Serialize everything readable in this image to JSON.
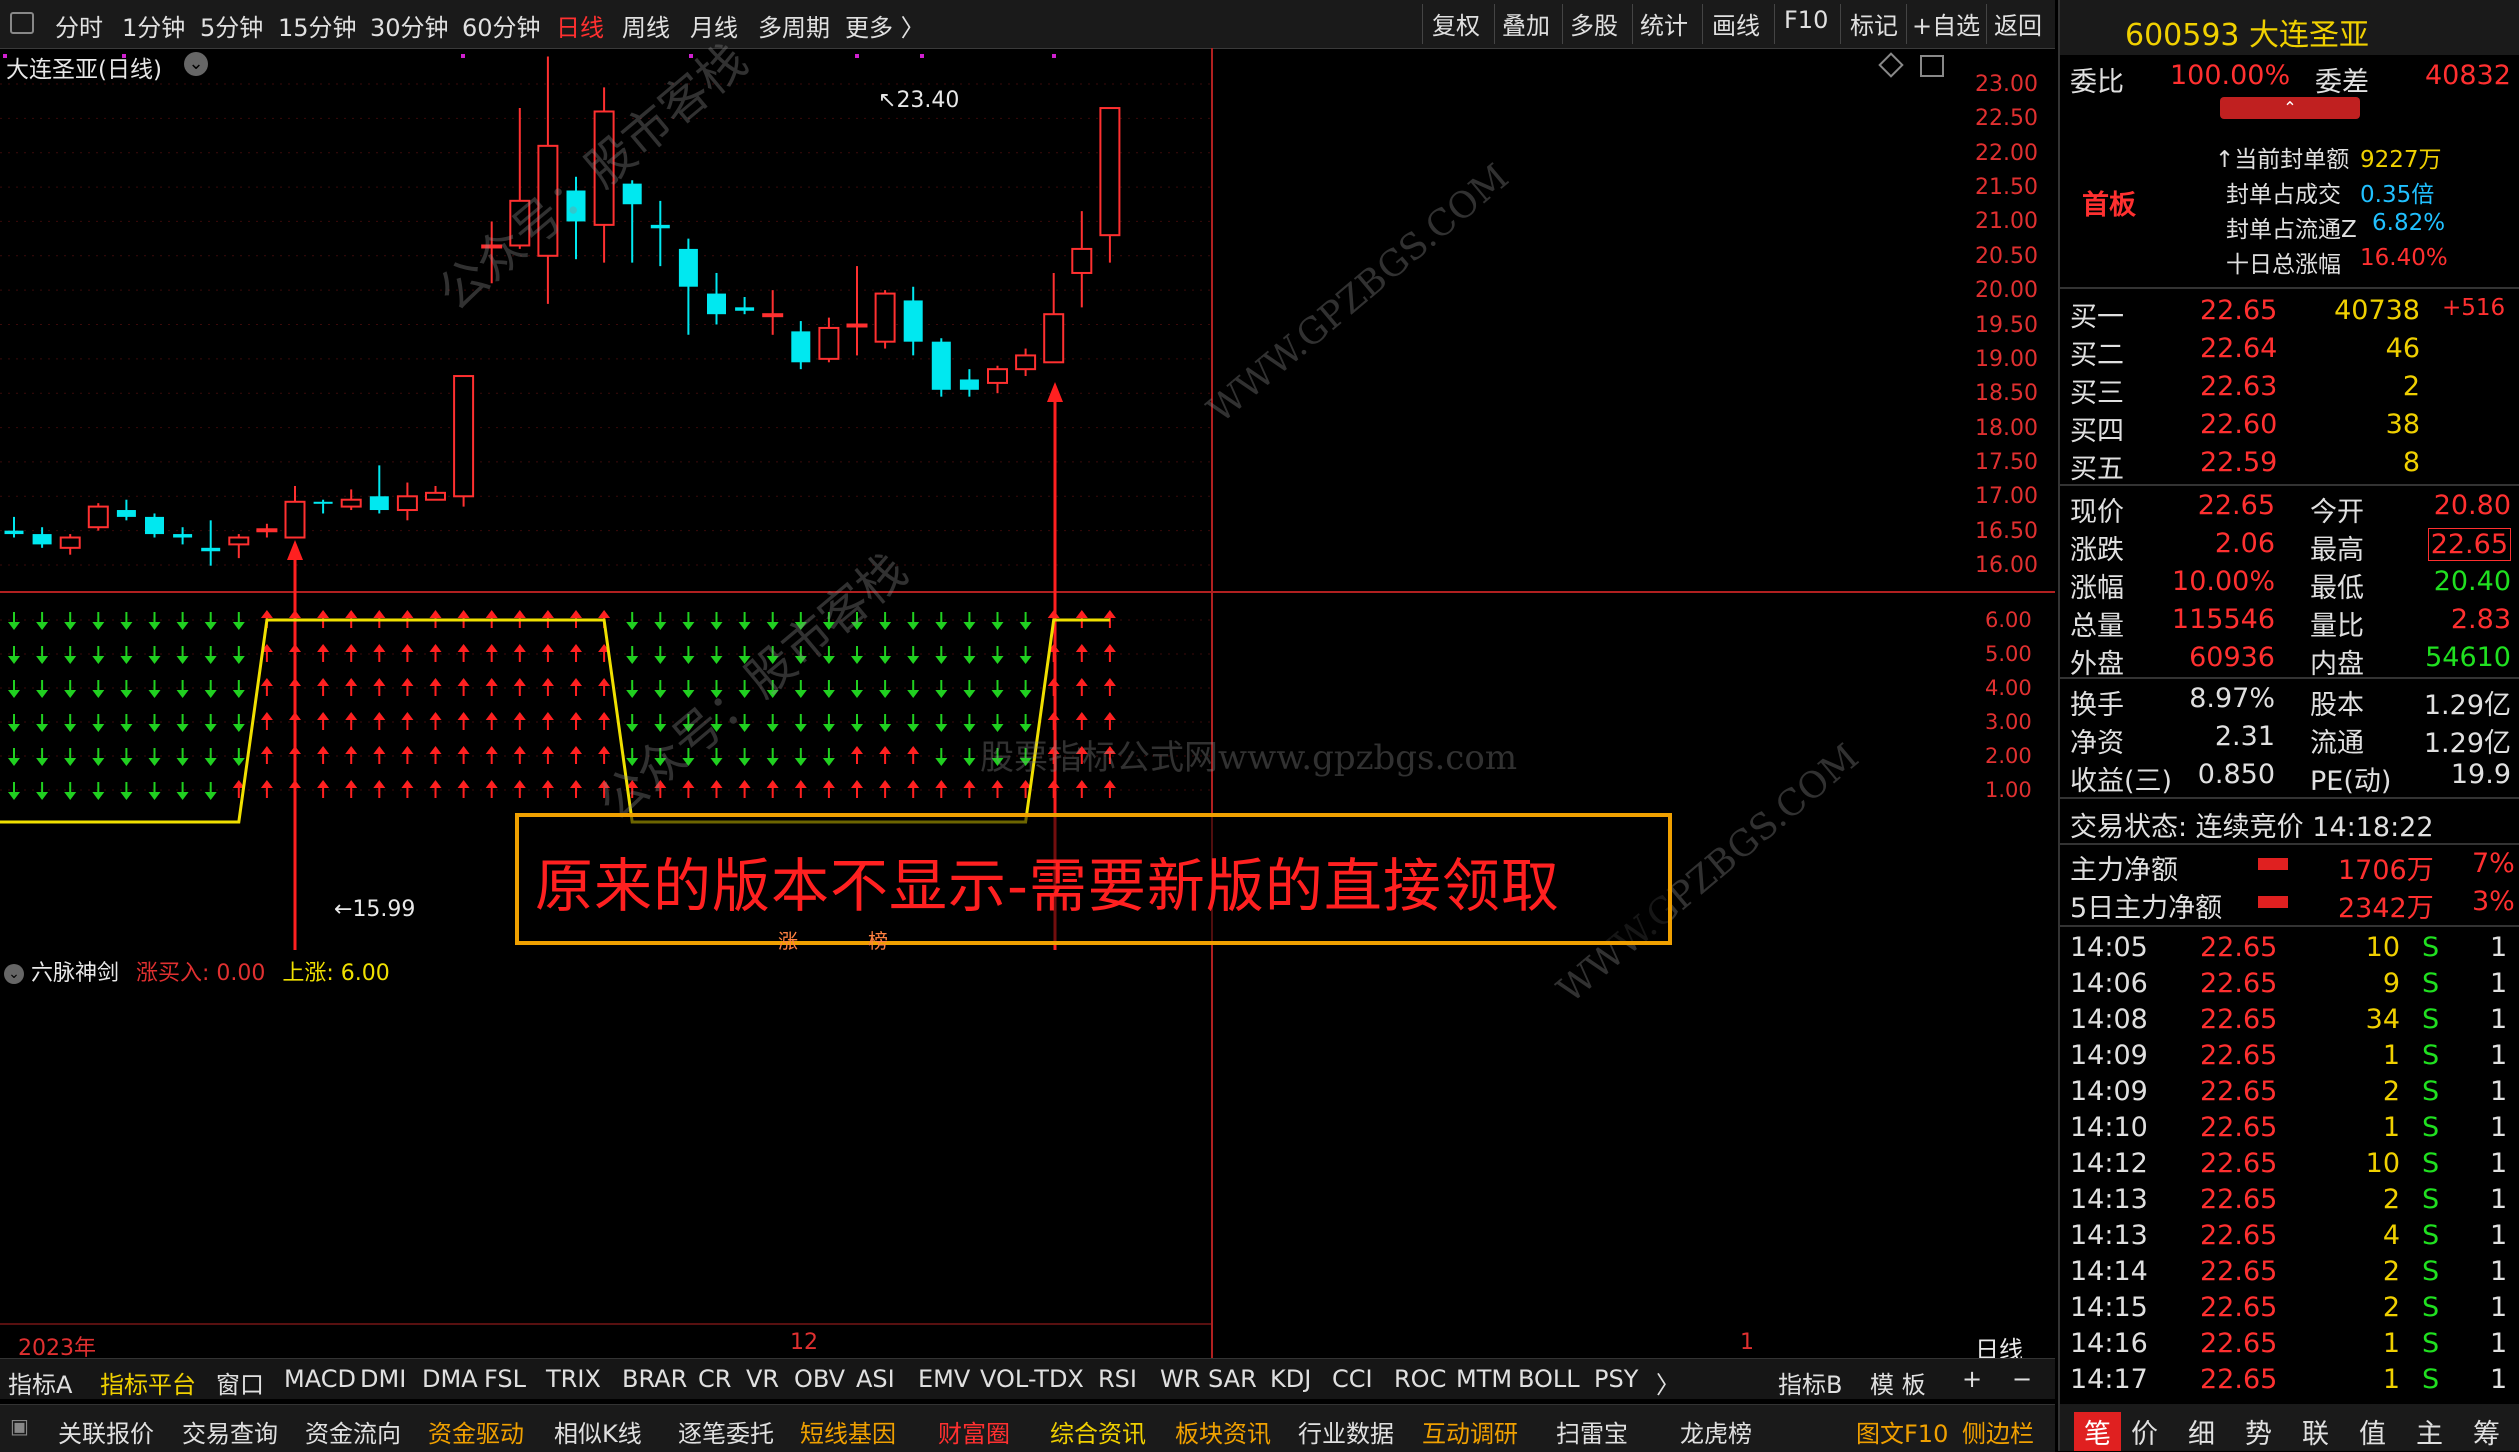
{
  "toolbar": {
    "periods": [
      "分时",
      "1分钟",
      "5分钟",
      "15分钟",
      "30分钟",
      "60分钟",
      "日线",
      "周线",
      "月线",
      "多周期",
      "更多 〉"
    ],
    "active_period": "日线",
    "buttons": [
      "复权",
      "叠加",
      "多股",
      "统计",
      "画线",
      "F10",
      "标记",
      "+自选",
      "返回"
    ]
  },
  "chart": {
    "title": "大连圣亚(日线)",
    "high_marker": "23.40",
    "low_marker": "15.99",
    "price_ticks": [
      "23.00",
      "22.50",
      "22.00",
      "21.50",
      "21.00",
      "20.50",
      "20.00",
      "19.50",
      "19.00",
      "18.50",
      "18.00",
      "17.50",
      "17.00",
      "16.50",
      "16.00"
    ],
    "watermark_center": "股票指标公式网www.gpzbgs.com",
    "watermark_side": "公众号：股市客栈",
    "watermark_url": "WWW.GPZBGS.COM",
    "notice": "原来的版本不显示-需要新版的直接领取",
    "tag_1": "涨",
    "tag_2": "榜",
    "x_label_1": "2023年",
    "x_label_2": "12",
    "x_label_3": "1",
    "corner_label": "日线"
  },
  "indicator": {
    "name": "六脉神剑",
    "line1": "涨买入: 0.00",
    "line2": "上涨: 6.00",
    "ticks": [
      "6.00",
      "5.00",
      "4.00",
      "3.00",
      "2.00",
      "1.00"
    ],
    "up_color": "#ff2020",
    "down_color": "#20d020"
  },
  "tabs": [
    "指标A",
    "指标平台",
    "窗口",
    "MACD",
    "DMI",
    "DMA",
    "FSL",
    "TRIX",
    "BRAR",
    "CR",
    "VR",
    "OBV",
    "ASI",
    "EMV",
    "VOL-TDX",
    "RSI",
    "WR",
    "SAR",
    "KDJ",
    "CCI",
    "ROC",
    "MTM",
    "BOLL",
    "PSY",
    "〉"
  ],
  "tabs_right": [
    "指标B",
    "模 板",
    "+",
    "−"
  ],
  "bottom_buttons": [
    "关联报价",
    "交易查询",
    "资金流向",
    "资金驱动",
    "相似K线",
    "逐笔委托",
    "短线基因",
    "财富圈",
    "综合资讯",
    "板块资讯",
    "行业数据",
    "互动调研",
    "扫雷宝",
    "龙虎榜",
    "图文F10",
    "侧边栏"
  ],
  "quote": {
    "code_name": "600593 大连圣亚",
    "weibi_label": "委比",
    "weibi": "100.00%",
    "weicha_label": "委差",
    "weicha": "40832",
    "badge": "首板",
    "seal_amount_label": "当前封单额",
    "seal_amount": "9227万",
    "seal_ratio_label": "封单占成交",
    "seal_ratio": "0.35倍",
    "seal_float_label": "封单占流通Z",
    "seal_float": "6.82%",
    "ten_day_label": "十日总涨幅",
    "ten_day": "16.40%",
    "bids": [
      {
        "label": "买一",
        "price": "22.65",
        "vol": "40738",
        "chg": "+516"
      },
      {
        "label": "买二",
        "price": "22.64",
        "vol": "46",
        "chg": ""
      },
      {
        "label": "买三",
        "price": "22.63",
        "vol": "2",
        "chg": ""
      },
      {
        "label": "买四",
        "price": "22.60",
        "vol": "38",
        "chg": ""
      },
      {
        "label": "买五",
        "price": "22.59",
        "vol": "8",
        "chg": ""
      }
    ],
    "stats": [
      {
        "l1": "现价",
        "v1": "22.65",
        "l2": "今开",
        "v2": "20.80"
      },
      {
        "l1": "涨跌",
        "v1": "2.06",
        "l2": "最高",
        "v2": "22.65"
      },
      {
        "l1": "涨幅",
        "v1": "10.00%",
        "l2": "最低",
        "v2": "20.40"
      },
      {
        "l1": "总量",
        "v1": "115546",
        "l2": "量比",
        "v2": "2.83"
      },
      {
        "l1": "外盘",
        "v1": "60936",
        "l2": "内盘",
        "v2": "54610"
      }
    ],
    "stats2": [
      {
        "l1": "换手",
        "v1": "8.97%",
        "l2": "股本",
        "v2": "1.29亿"
      },
      {
        "l1": "净资",
        "v1": "2.31",
        "l2": "流通",
        "v2": "1.29亿"
      },
      {
        "l1": "收益(三)",
        "v1": "0.850",
        "l2": "PE(动)",
        "v2": "19.9"
      }
    ],
    "trade_status": "交易状态: 连续竞价 14:18:22",
    "main_net_label": "主力净额",
    "main_net": "1706万",
    "main_net_pct": "7%",
    "main_net5_label": "5日主力净额",
    "main_net5": "2342万",
    "main_net5_pct": "3%",
    "ticks": [
      {
        "t": "14:05",
        "p": "22.65",
        "v": "10",
        "s": "S",
        "n": "1"
      },
      {
        "t": "14:06",
        "p": "22.65",
        "v": "9",
        "s": "S",
        "n": "1"
      },
      {
        "t": "14:08",
        "p": "22.65",
        "v": "34",
        "s": "S",
        "n": "1"
      },
      {
        "t": "14:09",
        "p": "22.65",
        "v": "1",
        "s": "S",
        "n": "1"
      },
      {
        "t": "14:09",
        "p": "22.65",
        "v": "2",
        "s": "S",
        "n": "1"
      },
      {
        "t": "14:10",
        "p": "22.65",
        "v": "1",
        "s": "S",
        "n": "1"
      },
      {
        "t": "14:12",
        "p": "22.65",
        "v": "10",
        "s": "S",
        "n": "1"
      },
      {
        "t": "14:13",
        "p": "22.65",
        "v": "2",
        "s": "S",
        "n": "1"
      },
      {
        "t": "14:13",
        "p": "22.65",
        "v": "4",
        "s": "S",
        "n": "1"
      },
      {
        "t": "14:14",
        "p": "22.65",
        "v": "2",
        "s": "S",
        "n": "1"
      },
      {
        "t": "14:15",
        "p": "22.65",
        "v": "2",
        "s": "S",
        "n": "1"
      },
      {
        "t": "14:16",
        "p": "22.65",
        "v": "1",
        "s": "S",
        "n": "1"
      },
      {
        "t": "14:17",
        "p": "22.65",
        "v": "1",
        "s": "S",
        "n": "1"
      }
    ],
    "bottom_tabs": [
      "笔",
      "价",
      "细",
      "势",
      "联",
      "值",
      "主",
      "筹"
    ]
  },
  "chart_data": {
    "type": "candlestick",
    "title": "大连圣亚(日线)",
    "ylim": [
      15.9,
      23.5
    ],
    "candles": [
      {
        "o": 16.5,
        "c": 16.45,
        "h": 16.7,
        "l": 16.4
      },
      {
        "o": 16.45,
        "c": 16.3,
        "h": 16.55,
        "l": 16.25
      },
      {
        "o": 16.25,
        "c": 16.4,
        "h": 16.45,
        "l": 16.15
      },
      {
        "o": 16.55,
        "c": 16.85,
        "h": 16.9,
        "l": 16.5
      },
      {
        "o": 16.8,
        "c": 16.7,
        "h": 16.95,
        "l": 16.65
      },
      {
        "o": 16.7,
        "c": 16.45,
        "h": 16.75,
        "l": 16.4
      },
      {
        "o": 16.45,
        "c": 16.4,
        "h": 16.55,
        "l": 16.3
      },
      {
        "o": 16.25,
        "c": 16.2,
        "h": 16.65,
        "l": 15.99
      },
      {
        "o": 16.3,
        "c": 16.4,
        "h": 16.45,
        "l": 16.1
      },
      {
        "o": 16.5,
        "c": 16.52,
        "h": 16.6,
        "l": 16.4
      },
      {
        "o": 16.4,
        "c": 16.92,
        "h": 17.15,
        "l": 16.4
      },
      {
        "o": 16.92,
        "c": 16.9,
        "h": 16.95,
        "l": 16.75
      },
      {
        "o": 16.85,
        "c": 16.95,
        "h": 17.1,
        "l": 16.8
      },
      {
        "o": 17.0,
        "c": 16.8,
        "h": 17.45,
        "l": 16.75
      },
      {
        "o": 16.8,
        "c": 17.0,
        "h": 17.2,
        "l": 16.65
      },
      {
        "o": 16.95,
        "c": 17.05,
        "h": 17.15,
        "l": 16.95
      },
      {
        "o": 17.0,
        "c": 18.75,
        "h": 18.75,
        "l": 16.85
      },
      {
        "o": 20.65,
        "c": 20.65,
        "h": 21.0,
        "l": 20.1
      },
      {
        "o": 20.65,
        "c": 21.3,
        "h": 22.65,
        "l": 20.6
      },
      {
        "o": 20.5,
        "c": 22.1,
        "h": 23.4,
        "l": 19.8
      },
      {
        "o": 21.45,
        "c": 21.0,
        "h": 21.65,
        "l": 20.45
      },
      {
        "o": 20.95,
        "c": 22.6,
        "h": 22.95,
        "l": 20.4
      },
      {
        "o": 21.55,
        "c": 21.25,
        "h": 21.6,
        "l": 20.4
      },
      {
        "o": 20.95,
        "c": 20.9,
        "h": 21.3,
        "l": 20.35
      },
      {
        "o": 20.6,
        "c": 20.05,
        "h": 20.75,
        "l": 19.35
      },
      {
        "o": 19.95,
        "c": 19.65,
        "h": 20.25,
        "l": 19.5
      },
      {
        "o": 19.75,
        "c": 19.7,
        "h": 19.9,
        "l": 19.65
      },
      {
        "o": 19.65,
        "c": 19.65,
        "h": 20.0,
        "l": 19.35
      },
      {
        "o": 19.4,
        "c": 18.95,
        "h": 19.55,
        "l": 18.85
      },
      {
        "o": 19.0,
        "c": 19.45,
        "h": 19.6,
        "l": 18.95
      },
      {
        "o": 19.5,
        "c": 19.5,
        "h": 20.35,
        "l": 19.05
      },
      {
        "o": 19.25,
        "c": 19.95,
        "h": 20.0,
        "l": 19.15
      },
      {
        "o": 19.85,
        "c": 19.25,
        "h": 20.05,
        "l": 19.05
      },
      {
        "o": 19.25,
        "c": 18.55,
        "h": 19.3,
        "l": 18.45
      },
      {
        "o": 18.7,
        "c": 18.55,
        "h": 18.85,
        "l": 18.45
      },
      {
        "o": 18.65,
        "c": 18.85,
        "h": 18.9,
        "l": 18.5
      },
      {
        "o": 18.85,
        "c": 19.05,
        "h": 19.15,
        "l": 18.75
      },
      {
        "o": 18.95,
        "c": 19.65,
        "h": 20.25,
        "l": 18.95
      },
      {
        "o": 20.25,
        "c": 20.6,
        "h": 21.15,
        "l": 19.75
      },
      {
        "o": 20.8,
        "c": 22.65,
        "h": 22.65,
        "l": 20.4
      }
    ],
    "indicator_up_count": [
      0,
      0,
      0,
      0,
      0,
      0,
      0,
      0,
      1,
      6,
      6,
      6,
      6,
      6,
      6,
      6,
      6,
      6,
      6,
      6,
      6,
      6,
      1,
      1,
      1,
      1,
      1,
      1,
      1,
      1,
      2,
      2,
      2,
      1,
      1,
      1,
      1,
      6,
      6,
      6
    ],
    "x_tick_labels": [
      "2023年",
      "12",
      "1"
    ]
  }
}
